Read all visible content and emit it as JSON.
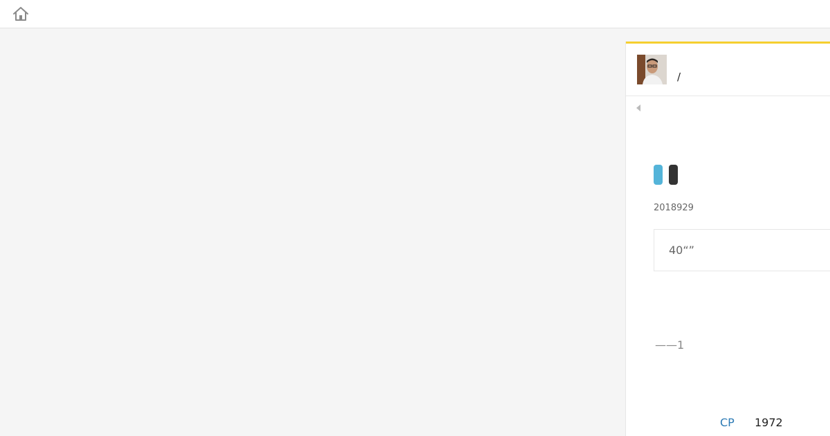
{
  "header": {
    "home_icon": "home-icon"
  },
  "article": {
    "author_separator": "/",
    "title": "",
    "tags": [
      {
        "color": "#54b4d9"
      },
      {
        "color": "#333333"
      }
    ],
    "date": "2018929",
    "summary": "40“”",
    "signature": "——1"
  },
  "footer": {
    "link_label": "CP",
    "year": "1972"
  },
  "colors": {
    "accent": "#f5cf2f",
    "link": "#2d7bb5",
    "background": "#f5f5f5"
  }
}
